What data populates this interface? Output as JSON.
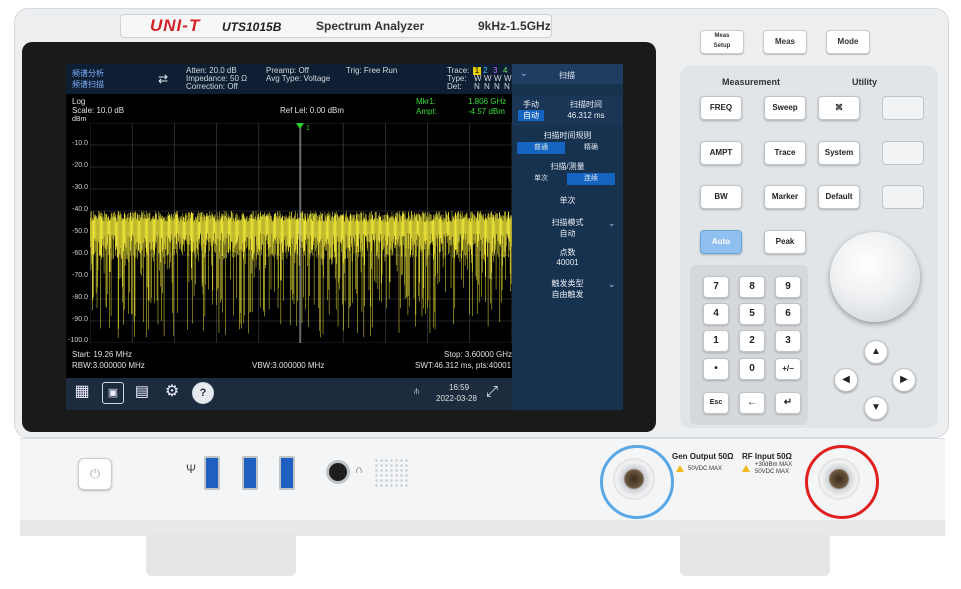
{
  "device": {
    "brand": "UNI-T",
    "model": "UTS1015B",
    "title": "Spectrum Analyzer",
    "range": "9kHz-1.5GHz"
  },
  "screen": {
    "mode": "频谱分析",
    "submode": "频谱扫描",
    "atten": "Atten: 20.0 dB",
    "impedance": "Impedance: 50 Ω",
    "correction": "Correction: Off",
    "preamp": "Preamp: Off",
    "avg_type": "Avg Type: Voltage",
    "trig": "Trig: Free Run",
    "trace_label": "Trace:",
    "type_label": "Type:",
    "det_label": "Det:",
    "trace_nums": [
      "1",
      "2",
      "3",
      "4"
    ],
    "type_vals": [
      "W",
      "W",
      "W",
      "W"
    ],
    "det_vals": [
      "N",
      "N",
      "N",
      "N"
    ],
    "scale_type": "Log",
    "scale": "Scale: 10.0 dB",
    "ref_level": "Ref Lel: 0.00 dBm",
    "unit": "dBm",
    "marker": "Mkr1:",
    "marker_freq": "1.806 GHz",
    "ampt": "Ampt:",
    "marker_ampt": "-4.57 dBm",
    "marker_tag": "1",
    "y_ticks": [
      "-10.0",
      "-20.0",
      "-30.0",
      "-40.0",
      "-50.0",
      "-60.0",
      "-70.0",
      "-80.0",
      "-90.0",
      "-100.0"
    ],
    "start": "Start: 19.26 MHz",
    "stop": "Stop: 3.60000 GHz",
    "rbw": "RBW:3.000000 MHz",
    "vbw": "VBW:3.000000 MHz",
    "swt": "SWT:46.312 ms, pts:40001",
    "time": "16:59",
    "date": "2022-03-28",
    "taskbar_icons": [
      "grid-icon",
      "screenshot-icon",
      "folder-icon",
      "settings-icon",
      "help-icon",
      "usb-icon",
      "fullscreen-icon"
    ]
  },
  "menu": {
    "title": "扫描",
    "sweep_time_label": "扫描时间",
    "manual": "手动",
    "auto": "自动",
    "sweep_time_value": "46.312 ms",
    "rule_label": "扫描时间规则",
    "rule_normal": "普通",
    "rule_accurate": "精确",
    "sweep_meas_label": "扫描/测量",
    "single": "单次",
    "continuous": "连续",
    "single_btn": "单次",
    "mode_label": "扫描模式",
    "mode_value": "自动",
    "points_label": "点数",
    "points_value": "40001",
    "trigger_label": "触发类型",
    "trigger_value": "自由触发"
  },
  "panel": {
    "top_buttons": [
      "Meas\nSetup",
      "Meas",
      "Mode"
    ],
    "measurement_label": "Measurement",
    "utility_label": "Utility",
    "keys": [
      "FREQ",
      "Sweep",
      "AMPT",
      "Trace",
      "System",
      "BW",
      "Marker",
      "Default",
      "Auto",
      "Peak"
    ],
    "numpad": [
      "7",
      "8",
      "9",
      "4",
      "5",
      "6",
      "1",
      "2",
      "3",
      "•",
      "0",
      "+/−",
      "Esc",
      "←",
      "↵"
    ]
  },
  "front": {
    "gen_output": "Gen Output 50Ω",
    "gen_max": "50VDC MAX",
    "rf_input": "RF Input 50Ω",
    "rf_max1": "+30dBm MAX",
    "rf_max2": "50VDC MAX"
  },
  "colors": {
    "trace": "#f2e93a",
    "brand_red": "#d52027",
    "accent_blue": "#1565c0",
    "gen_ring": "#5aa7e6",
    "rf_ring": "#e0201f"
  }
}
